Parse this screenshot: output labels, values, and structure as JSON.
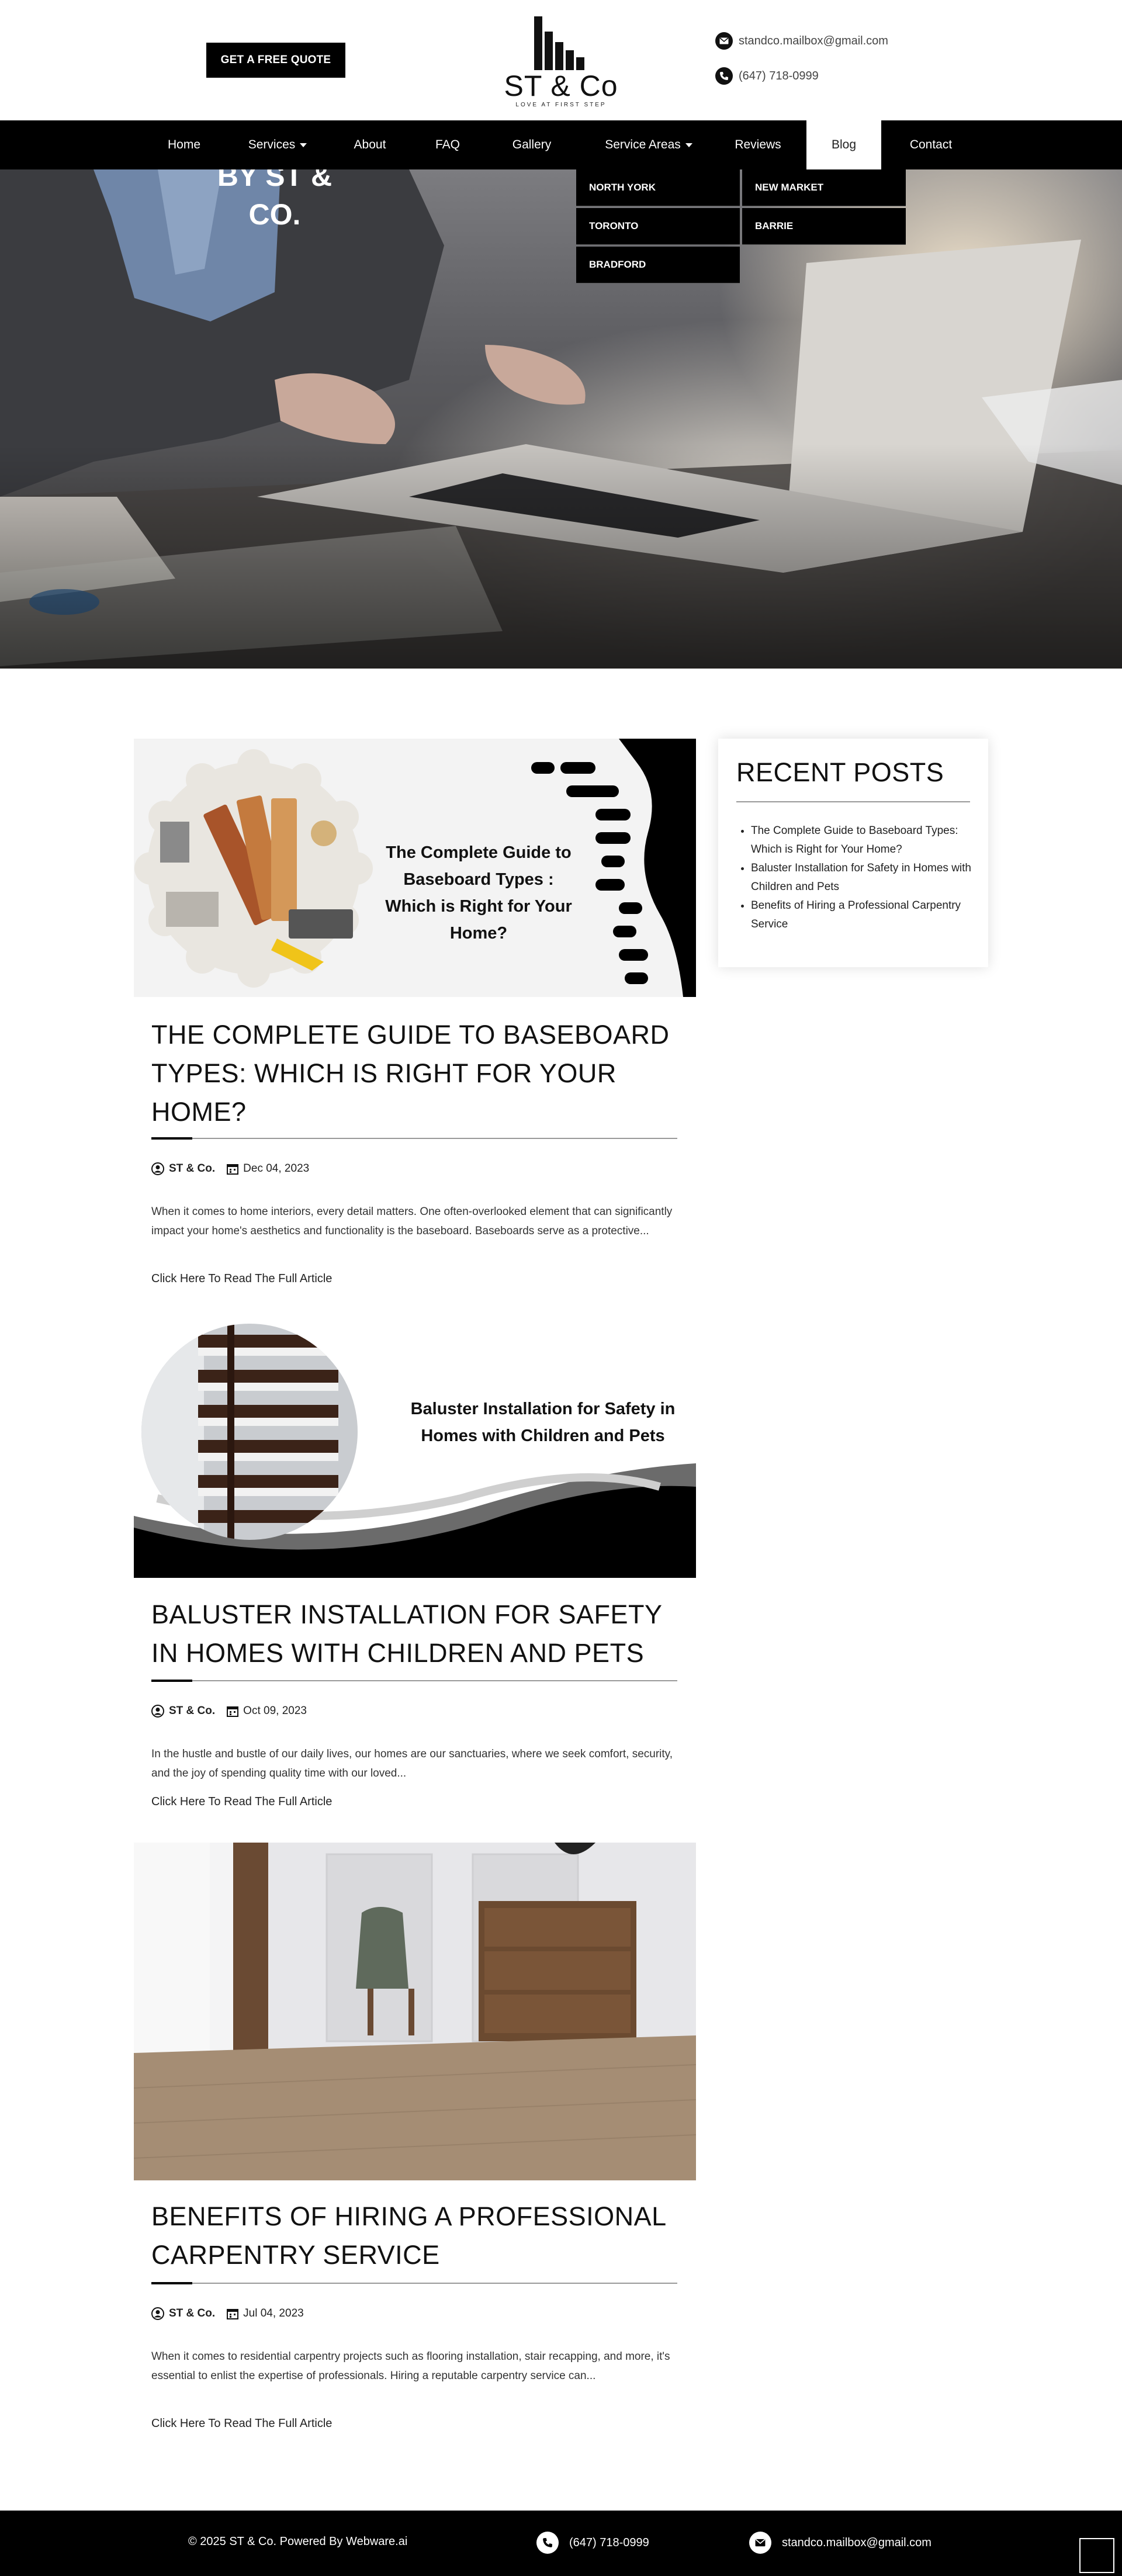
{
  "header": {
    "quote_button": "GET A FREE QUOTE",
    "logo_name": "ST & Co",
    "logo_tagline": "LOVE AT FIRST STEP",
    "email": "standco.mailbox@gmail.com",
    "phone": "(647) 718-0999"
  },
  "nav": {
    "items": [
      "Home",
      "Services",
      "About",
      "FAQ",
      "Gallery",
      "Service Areas",
      "Reviews",
      "Blog",
      "Contact"
    ],
    "active": "Blog"
  },
  "service_areas_dropdown": [
    "NORTH YORK",
    "NEW MARKET",
    "TORONTO",
    "BARRIE",
    "BRADFORD"
  ],
  "hero": {
    "title_line1": "BY ST &",
    "title_line2": "CO."
  },
  "posts": [
    {
      "image_caption": "The Complete Guide to Baseboard Types : Which is Right for Your Home?",
      "title": "THE COMPLETE GUIDE TO BASEBOARD TYPES: WHICH IS RIGHT FOR YOUR HOME?",
      "author": "ST & Co.",
      "date": "Dec 04, 2023",
      "excerpt": "When it comes to home interiors, every detail matters. One often-overlooked element that can significantly impact your home's aesthetics and functionality is the baseboard. Baseboards serve as a protective...",
      "read_more": "Click Here To Read The Full Article"
    },
    {
      "image_caption": "Baluster Installation for Safety in Homes with Children and Pets",
      "title": "BALUSTER INSTALLATION FOR SAFETY IN HOMES WITH CHILDREN AND PETS",
      "author": "ST & Co.",
      "date": "Oct 09, 2023",
      "excerpt": "In the hustle and bustle of our daily lives, our homes are our sanctuaries, where we seek comfort, security, and the joy of spending quality time with our loved...",
      "read_more": "Click Here To Read The Full Article"
    },
    {
      "title": "BENEFITS OF HIRING A PROFESSIONAL CARPENTRY SERVICE",
      "author": "ST & Co.",
      "date": "Jul 04, 2023",
      "excerpt": "When it comes to residential carpentry projects such as flooring installation, stair recapping, and more, it's essential to enlist the expertise of professionals. Hiring a reputable carpentry service can...",
      "read_more": "Click Here To Read The Full Article"
    }
  ],
  "sidebar": {
    "title": "RECENT POSTS",
    "items": [
      "The Complete Guide to Baseboard Types: Which is Right for Your Home?",
      "Baluster Installation for Safety in Homes with Children and Pets",
      "Benefits of Hiring a Professional Carpentry Service"
    ]
  },
  "footer": {
    "copyright": "© 2025 ST & Co. Powered By Webware.ai",
    "phone": "(647) 718-0999",
    "email": "standco.mailbox@gmail.com"
  },
  "icons": [
    "email-icon",
    "phone-icon",
    "user-icon",
    "calendar-icon",
    "caret-down-icon",
    "scroll-top-icon"
  ]
}
